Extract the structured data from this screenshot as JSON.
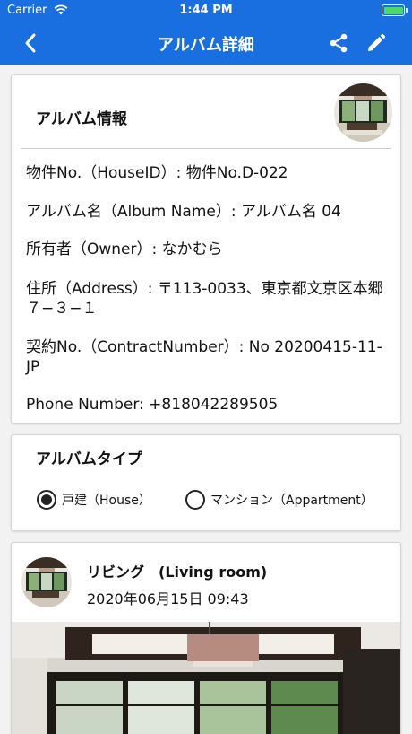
{
  "status_bar": {
    "carrier": "Carrier",
    "time": "1:44 PM"
  },
  "nav": {
    "title": "アルバム詳細",
    "back_icon": "chevron-left-icon",
    "share_icon": "share-icon",
    "edit_icon": "pencil-icon"
  },
  "album_info": {
    "title": "アルバム情報",
    "lines": [
      "物件No.（HouseID）: 物件No.D-022",
      "アルバム名（Album Name）: アルバム名 04",
      "所有者（Owner）: なかむら",
      "住所（Address）: 〒113-0033、東京都文京区本郷７−３−１",
      "契約No.（ContractNumber）: No 20200415-11-JP",
      "Phone Number: +818042289505"
    ]
  },
  "album_type": {
    "title": "アルバムタイプ",
    "options": [
      "戸建（House）",
      "マンション（Appartment）"
    ],
    "selected": "戸建（House）"
  },
  "room": {
    "title": "リビング　(Living room)",
    "date": "2020年06月15日 09:43"
  },
  "colors": {
    "header_blue": "#1a6fe0",
    "battery_green": "#4cd964"
  }
}
